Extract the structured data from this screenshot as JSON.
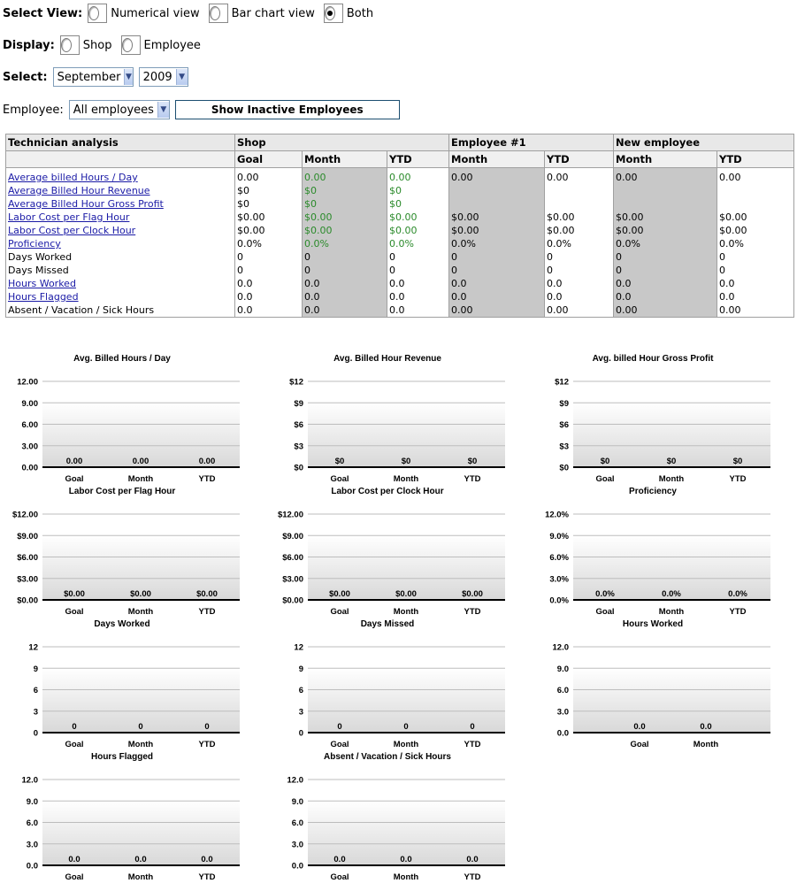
{
  "select_view": {
    "label": "Select View:",
    "options": [
      "Numerical view",
      "Bar chart view",
      "Both"
    ],
    "selected": "Both"
  },
  "display": {
    "label": "Display:",
    "options": [
      "Shop",
      "Employee"
    ]
  },
  "select": {
    "label": "Select:",
    "month": "September",
    "year": "2009"
  },
  "employee": {
    "label": "Employee:",
    "value": "All employees",
    "button": "Show Inactive Employees"
  },
  "table": {
    "header1": [
      "Technician analysis",
      "Shop",
      "Employee #1",
      "New employee"
    ],
    "header2": [
      "Goal",
      "Month",
      "YTD",
      "Month",
      "YTD",
      "Month",
      "YTD"
    ],
    "rows": [
      {
        "label": "Average billed Hours / Day",
        "link": true,
        "cells": [
          "0.00",
          "0.00",
          "0.00",
          "0.00",
          "0.00",
          "0.00",
          "0.00"
        ],
        "green": [
          1,
          2
        ]
      },
      {
        "label": "Average Billed Hour Revenue",
        "link": true,
        "cells": [
          "$0",
          "$0",
          "$0",
          "",
          "",
          "",
          ""
        ],
        "green": [
          1,
          2
        ]
      },
      {
        "label": "Average Billed Hour Gross Profit",
        "link": true,
        "cells": [
          "$0",
          "$0",
          "$0",
          "",
          "",
          "",
          ""
        ],
        "green": [
          1,
          2
        ]
      },
      {
        "label": "Labor Cost per Flag Hour",
        "link": true,
        "cells": [
          "$0.00",
          "$0.00",
          "$0.00",
          "$0.00",
          "$0.00",
          "$0.00",
          "$0.00"
        ],
        "green": [
          1,
          2
        ]
      },
      {
        "label": "Labor Cost per Clock Hour",
        "link": true,
        "cells": [
          "$0.00",
          "$0.00",
          "$0.00",
          "$0.00",
          "$0.00",
          "$0.00",
          "$0.00"
        ],
        "green": [
          1,
          2
        ]
      },
      {
        "label": "Proficiency",
        "link": true,
        "cells": [
          "0.0%",
          "0.0%",
          "0.0%",
          "0.0%",
          "0.0%",
          "0.0%",
          "0.0%"
        ],
        "green": [
          1,
          2
        ]
      },
      {
        "label": "Days Worked",
        "link": false,
        "cells": [
          "0",
          "0",
          "0",
          "0",
          "0",
          "0",
          "0"
        ],
        "green": []
      },
      {
        "label": "Days Missed",
        "link": false,
        "cells": [
          "0",
          "0",
          "0",
          "0",
          "0",
          "0",
          "0"
        ],
        "green": []
      },
      {
        "label": "Hours Worked",
        "link": true,
        "cells": [
          "0.0",
          "0.0",
          "0.0",
          "0.0",
          "0.0",
          "0.0",
          "0.0"
        ],
        "green": []
      },
      {
        "label": "Hours Flagged",
        "link": true,
        "cells": [
          "0.0",
          "0.0",
          "0.0",
          "0.0",
          "0.0",
          "0.0",
          "0.0"
        ],
        "green": []
      },
      {
        "label": "Absent / Vacation / Sick Hours",
        "link": false,
        "cells": [
          "0.0",
          "0.0",
          "0.0",
          "0.00",
          "0.00",
          "0.00",
          "0.00"
        ],
        "green": []
      }
    ]
  },
  "chart_data": [
    {
      "type": "bar",
      "title": "Avg. Billed Hours / Day",
      "categories": [
        "Goal",
        "Month",
        "YTD"
      ],
      "values": [
        0,
        0,
        0
      ],
      "value_labels": [
        "0.00",
        "0.00",
        "0.00"
      ],
      "ylim": [
        0,
        12
      ],
      "ticks": [
        "0.00",
        "3.00",
        "6.00",
        "9.00",
        "12.00"
      ]
    },
    {
      "type": "bar",
      "title": "Avg. Billed Hour Revenue",
      "categories": [
        "Goal",
        "Month",
        "YTD"
      ],
      "values": [
        0,
        0,
        0
      ],
      "value_labels": [
        "$0",
        "$0",
        "$0"
      ],
      "ylim": [
        0,
        12
      ],
      "ticks": [
        "$0",
        "$3",
        "$6",
        "$9",
        "$12"
      ]
    },
    {
      "type": "bar",
      "title": "Avg. billed Hour Gross Profit",
      "categories": [
        "Goal",
        "Month",
        "YTD"
      ],
      "values": [
        0,
        0,
        0
      ],
      "value_labels": [
        "$0",
        "$0",
        "$0"
      ],
      "ylim": [
        0,
        12
      ],
      "ticks": [
        "$0",
        "$3",
        "$6",
        "$9",
        "$12"
      ]
    },
    {
      "type": "bar",
      "title": "Labor Cost per Flag Hour",
      "categories": [
        "Goal",
        "Month",
        "YTD"
      ],
      "values": [
        0,
        0,
        0
      ],
      "value_labels": [
        "$0.00",
        "$0.00",
        "$0.00"
      ],
      "ylim": [
        0,
        12
      ],
      "ticks": [
        "$0.00",
        "$3.00",
        "$6.00",
        "$9.00",
        "$12.00"
      ]
    },
    {
      "type": "bar",
      "title": "Labor Cost per Clock Hour",
      "categories": [
        "Goal",
        "Month",
        "YTD"
      ],
      "values": [
        0,
        0,
        0
      ],
      "value_labels": [
        "$0.00",
        "$0.00",
        "$0.00"
      ],
      "ylim": [
        0,
        12
      ],
      "ticks": [
        "$0.00",
        "$3.00",
        "$6.00",
        "$9.00",
        "$12.00"
      ]
    },
    {
      "type": "bar",
      "title": "Proficiency",
      "categories": [
        "Goal",
        "Month",
        "YTD"
      ],
      "values": [
        0,
        0,
        0
      ],
      "value_labels": [
        "0.0%",
        "0.0%",
        "0.0%"
      ],
      "ylim": [
        0,
        12
      ],
      "ticks": [
        "0.0%",
        "3.0%",
        "6.0%",
        "9.0%",
        "12.0%"
      ]
    },
    {
      "type": "bar",
      "title": "Days Worked",
      "categories": [
        "Goal",
        "Month",
        "YTD"
      ],
      "values": [
        0,
        0,
        0
      ],
      "value_labels": [
        "0",
        "0",
        "0"
      ],
      "ylim": [
        0,
        12
      ],
      "ticks": [
        "0",
        "3",
        "6",
        "9",
        "12"
      ]
    },
    {
      "type": "bar",
      "title": "Days Missed",
      "categories": [
        "Goal",
        "Month",
        "YTD"
      ],
      "values": [
        0,
        0,
        0
      ],
      "value_labels": [
        "0",
        "0",
        "0"
      ],
      "ylim": [
        0,
        12
      ],
      "ticks": [
        "0",
        "3",
        "6",
        "9",
        "12"
      ]
    },
    {
      "type": "bar",
      "title": "Hours Worked",
      "categories": [
        "Goal",
        "Month"
      ],
      "values": [
        0,
        0
      ],
      "value_labels": [
        "0.0",
        "0.0"
      ],
      "ylim": [
        0,
        12
      ],
      "ticks": [
        "0.0",
        "3.0",
        "6.0",
        "9.0",
        "12.0"
      ]
    },
    {
      "type": "bar",
      "title": "Hours Flagged",
      "categories": [
        "Goal",
        "Month",
        "YTD"
      ],
      "values": [
        0,
        0,
        0
      ],
      "value_labels": [
        "0.0",
        "0.0",
        "0.0"
      ],
      "ylim": [
        0,
        12
      ],
      "ticks": [
        "0.0",
        "3.0",
        "6.0",
        "9.0",
        "12.0"
      ]
    },
    {
      "type": "bar",
      "title": "Absent / Vacation / Sick Hours",
      "categories": [
        "Goal",
        "Month",
        "YTD"
      ],
      "values": [
        0,
        0,
        0
      ],
      "value_labels": [
        "0.0",
        "0.0",
        "0.0"
      ],
      "ylim": [
        0,
        12
      ],
      "ticks": [
        "0.0",
        "3.0",
        "6.0",
        "9.0",
        "12.0"
      ]
    }
  ]
}
